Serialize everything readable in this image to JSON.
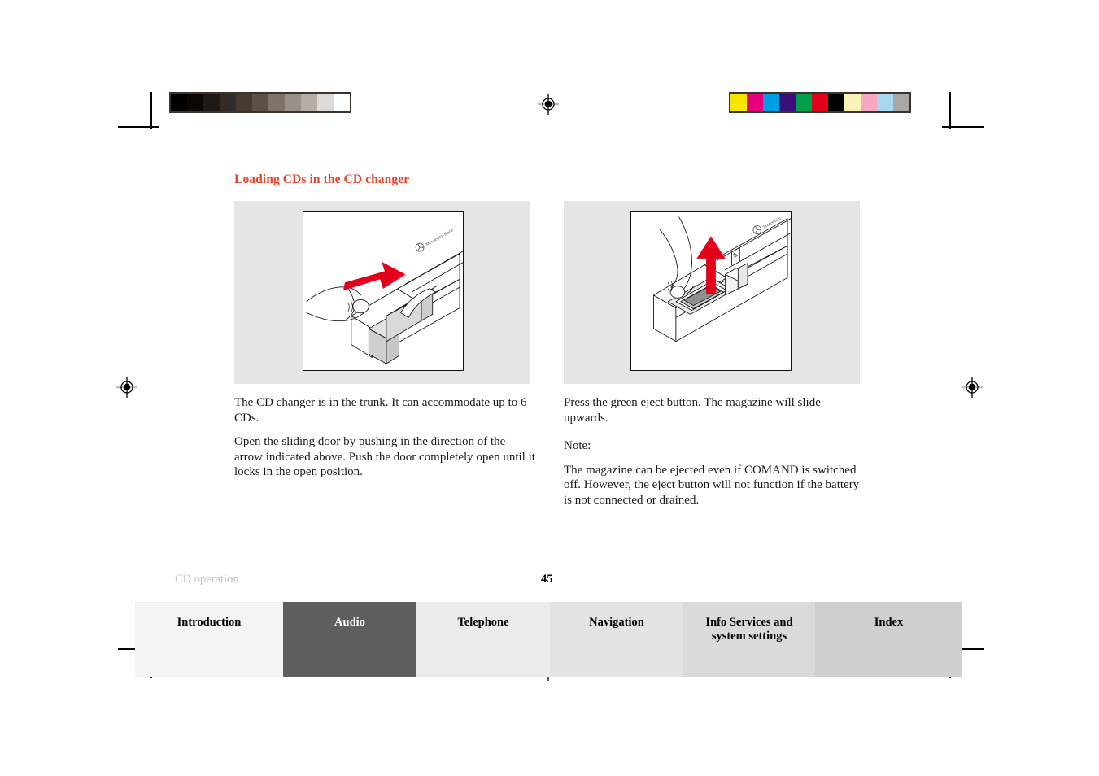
{
  "document": {
    "heading": "Loading CDs in the CD changer",
    "heading_color": "#e8452c",
    "page_number": "45",
    "running_footer": "CD operation"
  },
  "figures": {
    "left": {
      "caption_icon": "cd-changer-sliding-door-illustration",
      "arrow_direction": "right",
      "arrow_color": "#e3001b",
      "brand_label": "Mercedes-Benz"
    },
    "right": {
      "caption_icon": "cd-changer-eject-button-illustration",
      "arrow_direction": "up",
      "arrow_color": "#e3001b",
      "brand_label": "Mercedes"
    }
  },
  "text": {
    "left": [
      "The CD changer is in the trunk. It can accommodate up to 6 CDs.",
      "Open the sliding door by pushing in the direction of the arrow indicated above. Push the door completely open until it locks in the open position."
    ],
    "right": [
      "Press the green eject button. The magazine will slide upwards.",
      "Note:",
      "The magazine can be ejected even if COMAND is switched off. However, the eject button will not function if the battery is not connected or drained."
    ]
  },
  "tabs": [
    {
      "label": "Introduction",
      "active": false,
      "bg": "#f4f4f4",
      "color": "#000000"
    },
    {
      "label": "Audio",
      "active": true,
      "bg": "#5e5e5e",
      "color": "#ffffff"
    },
    {
      "label": "Telephone",
      "active": false,
      "bg": "#ebebeb",
      "color": "#000000"
    },
    {
      "label": "Navigation",
      "active": false,
      "bg": "#e3e3e3",
      "color": "#000000"
    },
    {
      "label": "Info Services and\nsystem settings",
      "active": false,
      "bg": "#dadada",
      "color": "#000000"
    },
    {
      "label": "Index",
      "active": false,
      "bg": "#cfcfcf",
      "color": "#000000"
    }
  ],
  "calibration": {
    "gray_strip": [
      "#000000",
      "#0c0806",
      "#1f1915",
      "#332b25",
      "#453b33",
      "#5c5149",
      "#7d736b",
      "#9a918a",
      "#b5aea8",
      "#dedbd7",
      "#ffffff"
    ],
    "color_strip": [
      "#f5e500",
      "#e5007e",
      "#009fe3",
      "#3b0f78",
      "#00a04a",
      "#e2001a",
      "#000000",
      "#f9f3b8",
      "#f5a8c0",
      "#a8d8f0",
      "#a8a8a8"
    ]
  }
}
